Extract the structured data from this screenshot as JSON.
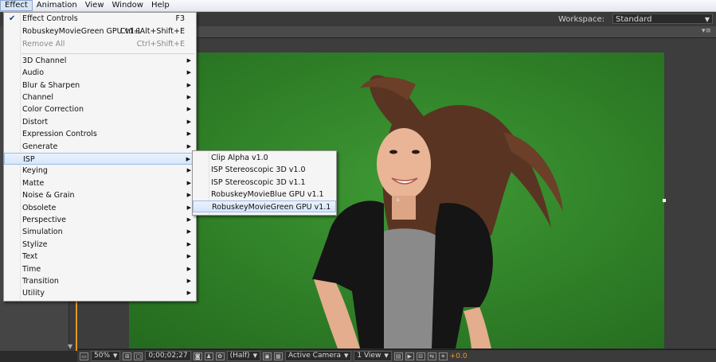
{
  "menubar": {
    "items": [
      {
        "label": "Effect",
        "active": true
      },
      {
        "label": "Animation",
        "active": false
      },
      {
        "label": "View",
        "active": false
      },
      {
        "label": "Window",
        "active": false
      },
      {
        "label": "Help",
        "active": false
      }
    ]
  },
  "workspace": {
    "label": "Workspace:",
    "value": "Standard"
  },
  "effect_menu": {
    "top_items": [
      {
        "label": "Effect Controls",
        "shortcut": "F3",
        "checked": true,
        "disabled": false
      },
      {
        "label": "RobuskeyMovieGreen GPU v1.1",
        "shortcut": "Ctrl+Alt+Shift+E",
        "checked": false,
        "disabled": false
      },
      {
        "label": "Remove All",
        "shortcut": "Ctrl+Shift+E",
        "checked": false,
        "disabled": true
      }
    ],
    "categories": [
      "3D Channel",
      "Audio",
      "Blur & Sharpen",
      "Channel",
      "Color Correction",
      "Distort",
      "Expression Controls",
      "Generate",
      "ISP",
      "Keying",
      "Matte",
      "Noise & Grain",
      "Obsolete",
      "Perspective",
      "Simulation",
      "Stylize",
      "Text",
      "Time",
      "Transition",
      "Utility"
    ],
    "highlighted_category": "ISP"
  },
  "isp_submenu": {
    "items": [
      "Clip Alpha v1.0",
      "ISP Stereoscopic 3D v1.0",
      "ISP Stereoscopic 3D v1.1",
      "RobuskeyMovieBlue GPU v1.1",
      "RobuskeyMovieGreen GPU v1.1"
    ],
    "highlighted_item": "RobuskeyMovieGreen GPU v1.1"
  },
  "viewer_toolbar": {
    "zoom": "50%",
    "timecode": "0;00;02;27",
    "resolution": "(Half)",
    "camera": "Active Camera",
    "views": "1 View",
    "exposure": "+0.0"
  },
  "colors": {
    "green_screen": "#2f7f27",
    "menu_highlight": "#d6e6fb",
    "accent_orange": "#e59a1e"
  }
}
